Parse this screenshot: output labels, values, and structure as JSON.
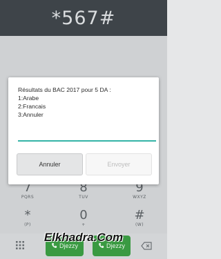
{
  "dialer": {
    "number": "*567#"
  },
  "keypad": {
    "keys": [
      {
        "digit": "7",
        "letters": "PQRS"
      },
      {
        "digit": "8",
        "letters": "TUV"
      },
      {
        "digit": "9",
        "letters": "WXYZ"
      },
      {
        "digit": "*",
        "letters": "(P)"
      },
      {
        "digit": "0",
        "letters": "+"
      },
      {
        "digit": "#",
        "letters": "(W)"
      }
    ]
  },
  "bottom_bar": {
    "call1_label": "Djezzy",
    "call2_label": "Djezzy"
  },
  "watermark": {
    "text": "Elkhadra.Com"
  },
  "dialog": {
    "lines": [
      "Résultats du BAC 2017 pour 5 DA :",
      "1:Arabe",
      "2:Francais",
      "3:Annuler"
    ],
    "input_value": "",
    "cancel_label": "Annuler",
    "send_label": "Envoyer"
  },
  "colors": {
    "header": "#3e4449",
    "accent": "#33b3a6",
    "call_green": "#3a9a42"
  }
}
